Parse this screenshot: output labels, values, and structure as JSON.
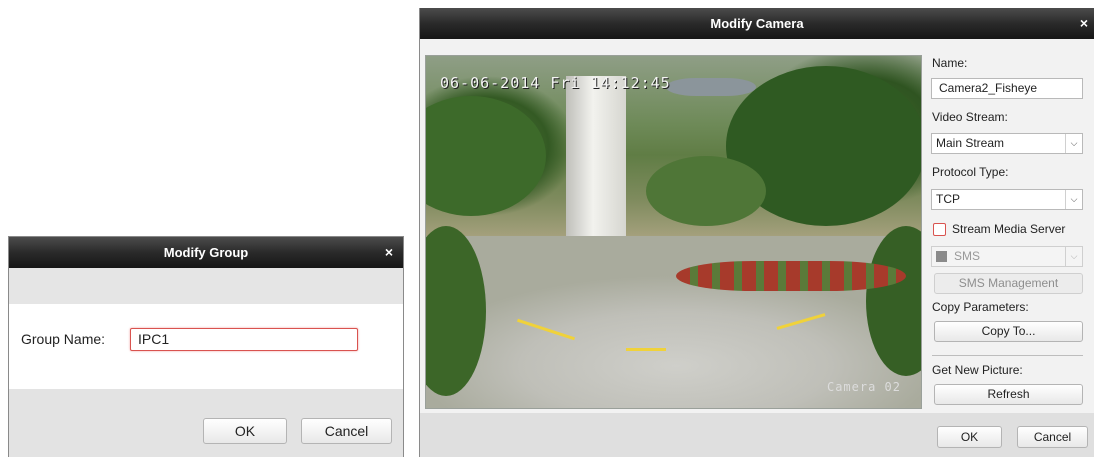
{
  "group_dialog": {
    "title": "Modify Group",
    "close_glyph": "×",
    "group_name_label": "Group Name:",
    "group_name_value": "IPC1",
    "ok_label": "OK",
    "cancel_label": "Cancel"
  },
  "camera_dialog": {
    "title": "Modify Camera",
    "close_glyph": "×",
    "preview": {
      "osd_timestamp": "06-06-2014 Fri 14:12:45",
      "osd_camera_name": "Camera 02"
    },
    "name_label": "Name:",
    "name_value": "Camera2_Fisheye",
    "video_stream_label": "Video Stream:",
    "video_stream_value": "Main Stream",
    "protocol_type_label": "Protocol Type:",
    "protocol_type_value": "TCP",
    "stream_media_server_label": "Stream Media Server",
    "stream_media_server_checked": false,
    "sms_value": "SMS",
    "sms_management_label": "SMS Management",
    "copy_parameters_label": "Copy Parameters:",
    "copy_to_label": "Copy To...",
    "get_new_picture_label": "Get New Picture:",
    "refresh_label": "Refresh",
    "ok_label": "OK",
    "cancel_label": "Cancel"
  },
  "colors": {
    "titlebar": "#1e1e1e",
    "field_error_border": "#d9534f",
    "dialog_bg": "#f2f2f2"
  }
}
